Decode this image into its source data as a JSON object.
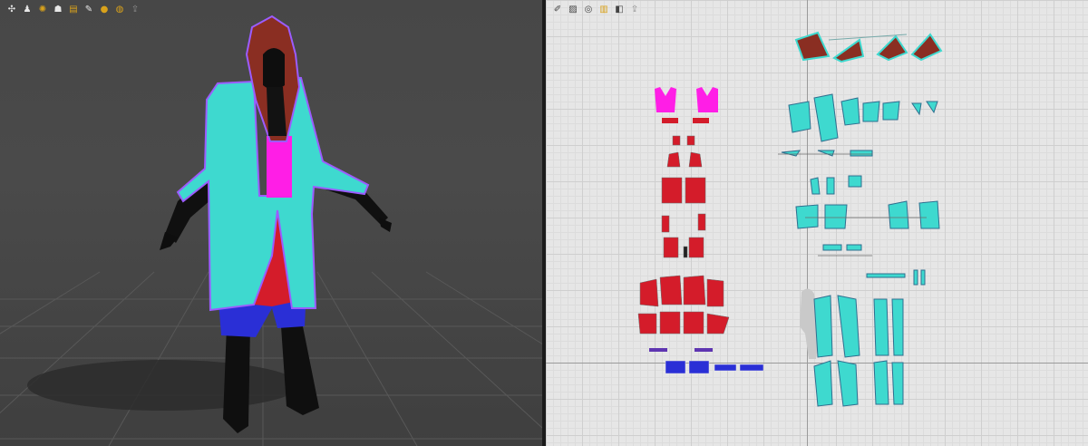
{
  "viewport3d": {
    "toolbar": [
      {
        "icon": "wrench-settings-icon",
        "glyph": "✣"
      },
      {
        "icon": "avatar-display-icon",
        "glyph": "♟"
      },
      {
        "icon": "simulation-icon",
        "glyph": "✺"
      },
      {
        "icon": "body-display-icon",
        "glyph": "☗"
      },
      {
        "icon": "texture-display-icon",
        "glyph": "▤"
      },
      {
        "icon": "pin-icon",
        "glyph": "✎"
      },
      {
        "icon": "skin-tone-icon",
        "glyph": "●"
      },
      {
        "icon": "fabric-render-icon",
        "glyph": "◍"
      },
      {
        "icon": "export-icon",
        "glyph": "⇪"
      }
    ]
  },
  "viewport2d": {
    "toolbar": [
      {
        "icon": "pattern-tool-icon",
        "glyph": "✐"
      },
      {
        "icon": "pattern-display-icon",
        "glyph": "▨"
      },
      {
        "icon": "search-pattern-icon",
        "glyph": "◎"
      },
      {
        "icon": "sewing-line-icon",
        "glyph": "▥"
      },
      {
        "icon": "annotation-icon",
        "glyph": "◧"
      },
      {
        "icon": "export-icon",
        "glyph": "⇪"
      }
    ]
  },
  "colors": {
    "coat": "#3ed9cf",
    "coat_outline": "#9b5cff",
    "hood": "#8a2e22",
    "top": "#ff1ee6",
    "pants": "#d41c2a",
    "leggings": "#2a2fd6",
    "skin": "#101010"
  }
}
